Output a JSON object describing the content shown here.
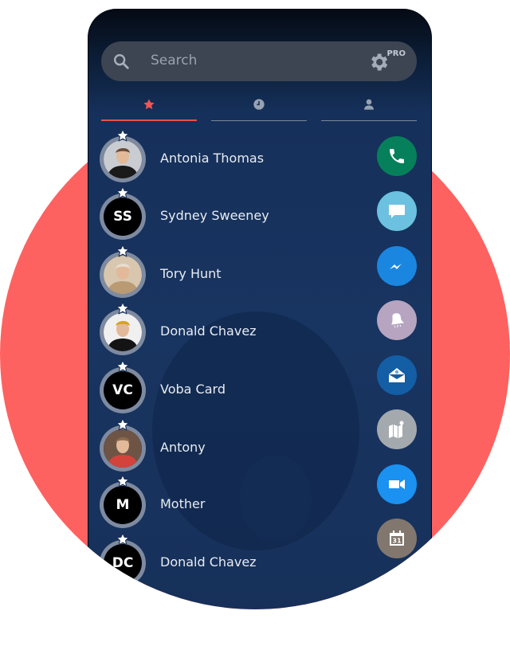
{
  "search": {
    "placeholder": "Search",
    "pro_badge": "PRO"
  },
  "tabs": [
    {
      "name": "favorites",
      "icon": "star-icon",
      "active": true
    },
    {
      "name": "recents",
      "icon": "clock-icon",
      "active": false
    },
    {
      "name": "contacts",
      "icon": "person-icon",
      "active": false
    }
  ],
  "contacts": [
    {
      "name": "Antonia Thomas",
      "initials": "",
      "photo": true,
      "favorite": true
    },
    {
      "name": "Sydney Sweeney",
      "initials": "SS",
      "photo": false,
      "favorite": true
    },
    {
      "name": "Tory Hunt",
      "initials": "",
      "photo": true,
      "favorite": true
    },
    {
      "name": "Donald Chavez",
      "initials": "",
      "photo": true,
      "favorite": true
    },
    {
      "name": "Voba Card",
      "initials": "VC",
      "photo": false,
      "favorite": true
    },
    {
      "name": "Antony",
      "initials": "",
      "photo": true,
      "favorite": true
    },
    {
      "name": "Mother",
      "initials": "M",
      "photo": false,
      "favorite": true
    },
    {
      "name": "Donald Chavez",
      "initials": "DC",
      "photo": false,
      "favorite": true
    }
  ],
  "actions": [
    {
      "name": "call",
      "icon": "phone-icon",
      "color": "#06805a"
    },
    {
      "name": "sms",
      "icon": "message-icon",
      "color": "#6bc1df"
    },
    {
      "name": "messenger",
      "icon": "messenger-icon",
      "color": "#1a86e0"
    },
    {
      "name": "reminder",
      "icon": "bell-icon",
      "color": "#b6a4c0"
    },
    {
      "name": "email",
      "icon": "email-icon",
      "color": "#135ea4"
    },
    {
      "name": "map",
      "icon": "map-icon",
      "color": "#a4a9ae"
    },
    {
      "name": "video-call",
      "icon": "video-icon",
      "color": "#1b91f1"
    },
    {
      "name": "calendar",
      "icon": "calendar-icon",
      "color": "#82776e",
      "label": "31"
    }
  ],
  "colors": {
    "accent": "#e9504d",
    "background_circle": "#fd6260"
  }
}
